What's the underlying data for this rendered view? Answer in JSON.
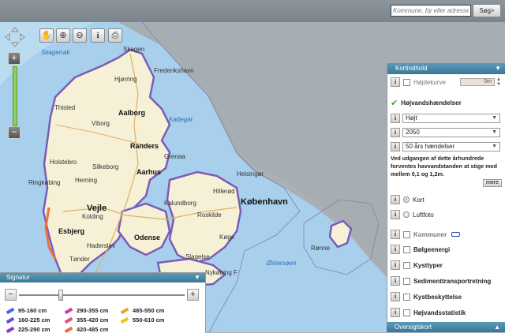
{
  "search": {
    "placeholder": "Kommune, by eller adresse",
    "button": "Søg>"
  },
  "toolbar": {
    "pan": "✋",
    "zoom_in": "⊕",
    "zoom_out": "⊖",
    "info": "i",
    "print": "⎙"
  },
  "zoom": {
    "plus": "+",
    "minus": "−"
  },
  "map_labels": {
    "skagerrak": "Skagerrak",
    "skagen": "Skagen",
    "frederikshavn": "Frederikshavn",
    "hjorring": "Hjørring",
    "thisted": "Thisted",
    "aalborg": "Aalborg",
    "kattegat": "Kattegat",
    "viborg": "Viborg",
    "randers": "Randers",
    "holstebro": "Holstebro",
    "silkeborg": "Silkeborg",
    "aarhus": "Aarhus",
    "grenaa": "Grenaa",
    "ringkobing": "Ringkøbing",
    "herning": "Herning",
    "helsingor": "Helsingør",
    "hillerod": "Hillerød",
    "kobenhavn": "København",
    "kalundborg": "Kalundborg",
    "roskilde": "Roskilde",
    "vejle": "Vejle",
    "kolding": "Kolding",
    "esbjerg": "Esbjerg",
    "haderslev": "Haderslev",
    "odense": "Odense",
    "slagelse": "Slagelse",
    "koge": "Køge",
    "ostersoen": "Østersøen",
    "ronne": "Rønne",
    "tonder": "Tønder",
    "nykobing": "Nykøbing F"
  },
  "panel": {
    "title": "Kortindhold",
    "hojdekurve": "Højdekurve",
    "hojdekurve_value": "0m",
    "hojvand": "Højvandshændelser",
    "select1": "Højt",
    "select2": "2050",
    "select3": "50 års hændelser",
    "description": "Ved udgangen af dette århundrede forventes havvandstanden at stige med mellem 0,1 og 1,2m.",
    "mere": "mere",
    "kort": "Kort",
    "luftfoto": "Luftfoto",
    "kommuner": "Kommuner",
    "bolgeenergi": "Bølgeenergi",
    "kysttyper": "Kysttyper",
    "sediment": "Sedimenttransportretning",
    "kystbeskyttelse": "Kystbeskyttelse",
    "statistik": "Højvandsstatistik"
  },
  "signatur": {
    "title": "Signatur",
    "items": [
      {
        "label": "95-160 cm",
        "color": "#4a6ad8"
      },
      {
        "label": "160-225 cm",
        "color": "#6a4ad8"
      },
      {
        "label": "225-290 cm",
        "color": "#8a3ac8"
      },
      {
        "label": "290-355 cm",
        "color": "#d23aa8"
      },
      {
        "label": "355-420 cm",
        "color": "#e0507a"
      },
      {
        "label": "420-485 cm",
        "color": "#ec7040"
      },
      {
        "label": "485-550 cm",
        "color": "#f0a030"
      },
      {
        "label": "550-610 cm",
        "color": "#f2c020"
      }
    ]
  },
  "oversigt": "Oversigtskort",
  "colors": {
    "sea": "#a8d0ec",
    "land": "#f6f0d6",
    "header": "#3a7797"
  }
}
